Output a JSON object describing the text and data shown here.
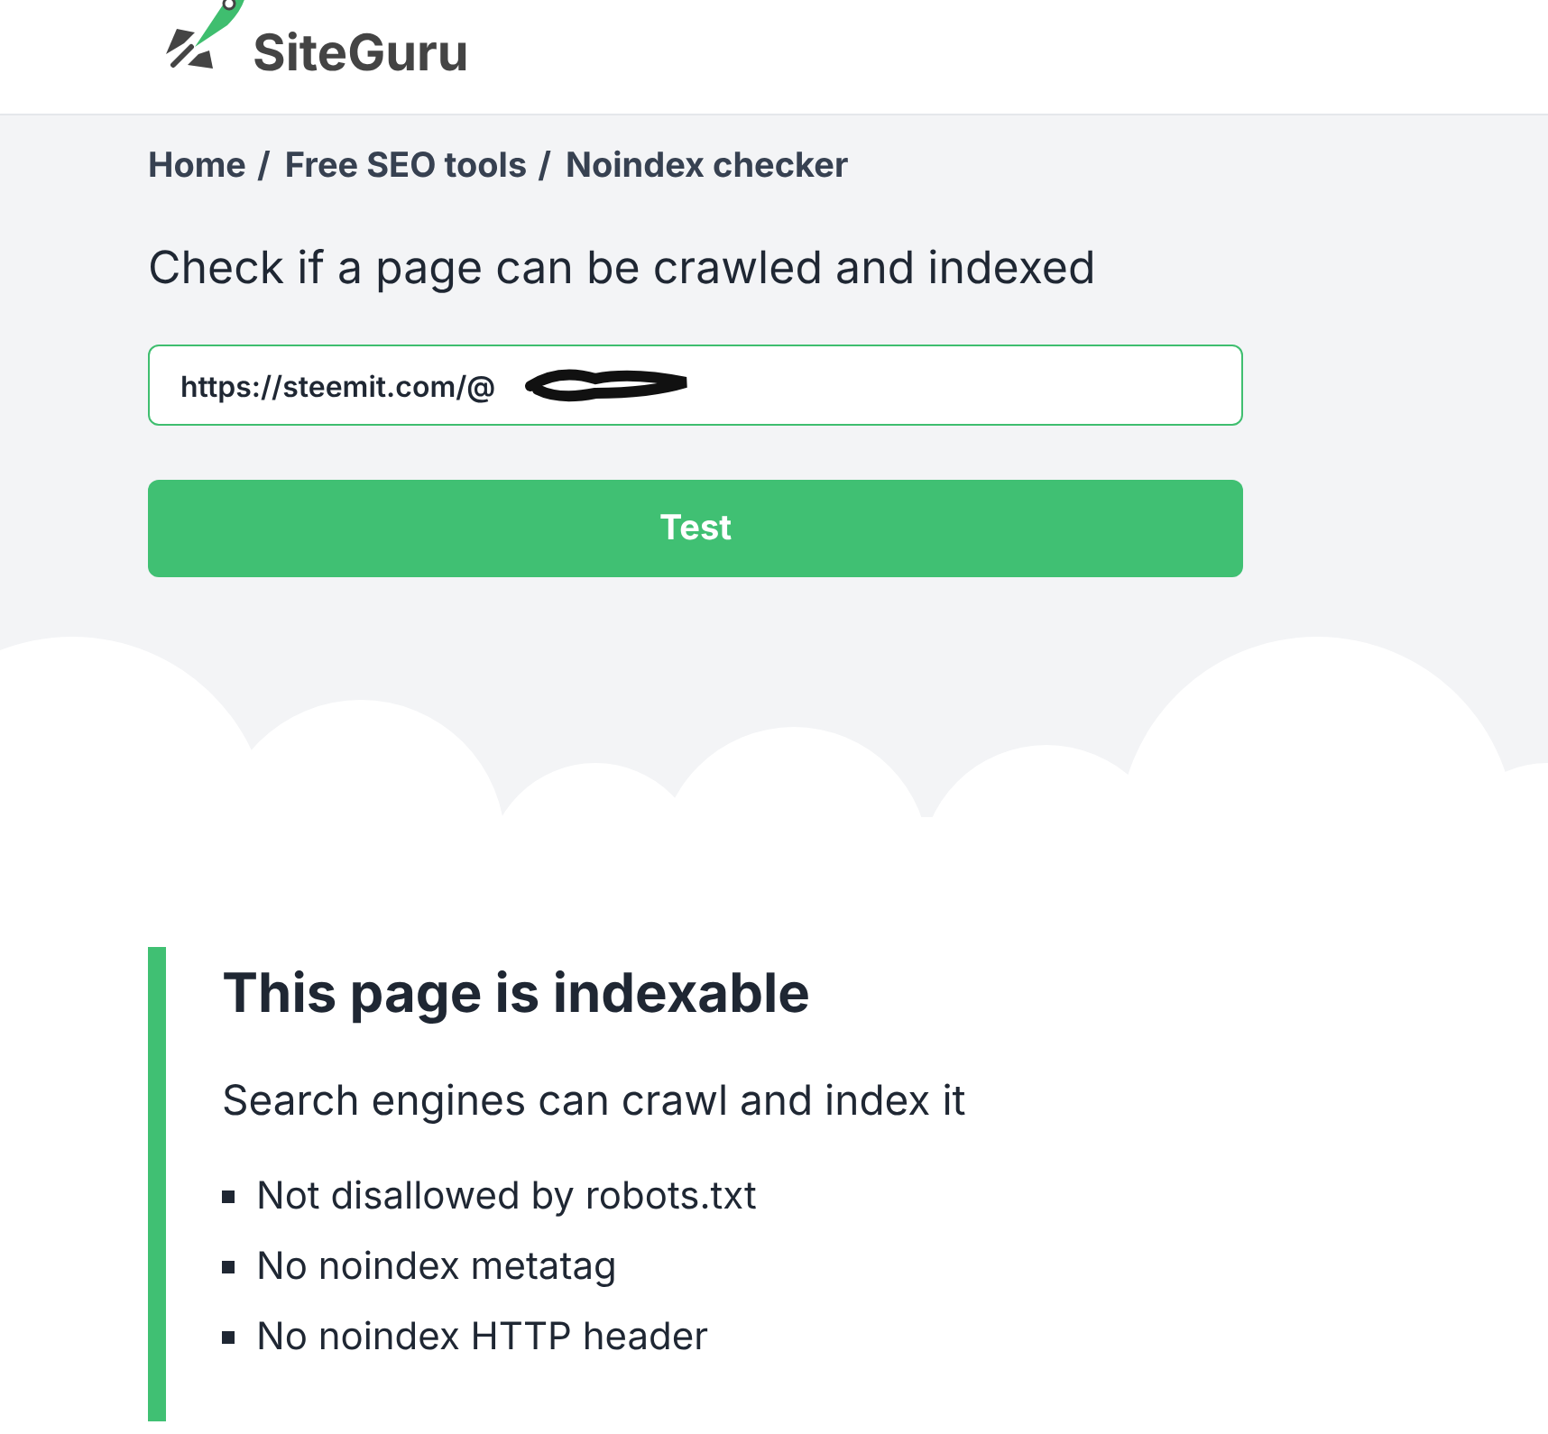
{
  "logo": {
    "name": "SiteGuru"
  },
  "breadcrumbs": [
    {
      "label": "Home",
      "separator": "/"
    },
    {
      "label": "Free SEO tools",
      "separator": "/"
    },
    {
      "label": "Noindex checker"
    }
  ],
  "heading": "Check if a page can be crawled and indexed",
  "url_field": {
    "value": "https://steemit.com/@",
    "redacted": true
  },
  "test_button": "Test",
  "result": {
    "title": "This page is indexable",
    "subtitle": "Search engines can crawl and index it",
    "checks": [
      "Not disallowed by robots.txt",
      "No noindex metatag",
      "No noindex HTTP header"
    ]
  }
}
